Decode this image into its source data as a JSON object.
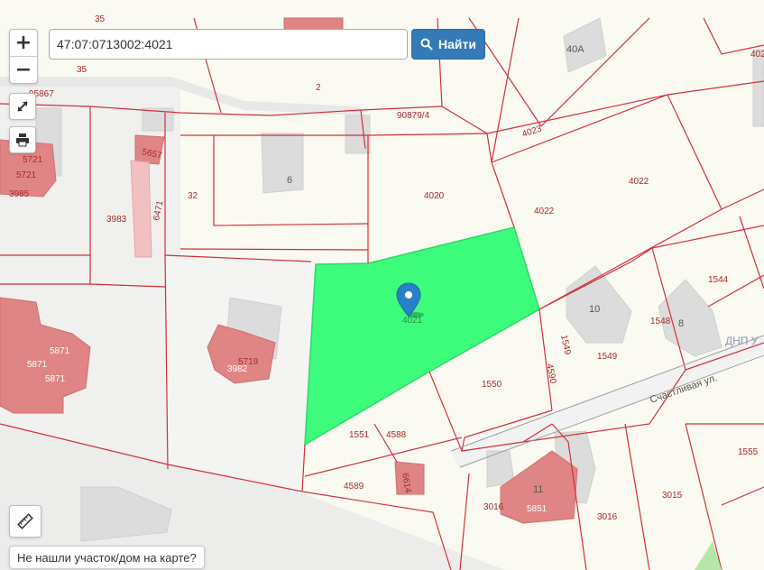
{
  "search": {
    "value": "47:07:0713002:4021",
    "button_label": "Найти",
    "button_icon": "search-icon"
  },
  "controls": {
    "zoom_in": "+",
    "zoom_out": "−",
    "fullscreen_icon": "expand-icon",
    "print_icon": "print-icon",
    "ruler_icon": "ruler-icon"
  },
  "not_found_label": "Не нашли участок/дом на карте?",
  "selected_parcel": {
    "label": "4021",
    "fill_color": "#3dfc7c",
    "marker_color": "#2a80c8"
  },
  "colors": {
    "parcel_border": "#d22f3a",
    "building_fill": "#e08585",
    "map_background": "#fbfaf2"
  },
  "parcel_labels": [
    "35",
    "2",
    "40А",
    "402",
    "90879/4",
    "95867",
    "35",
    "5657",
    "5721",
    "5721",
    "3985",
    "6",
    "32",
    "4020",
    "4023",
    "4022",
    "4022",
    "3983",
    "6471",
    "1544",
    "10",
    "1548",
    "8",
    "5871",
    "5871",
    "5871",
    "5719",
    "3982",
    "1549",
    "1549",
    "4590",
    "1550",
    "1551",
    "4588",
    "1555",
    "4589",
    "6614",
    "11",
    "3016",
    "5851",
    "3016",
    "3015"
  ],
  "area_label": "ДНП У",
  "street_label": "Счастливая ул."
}
